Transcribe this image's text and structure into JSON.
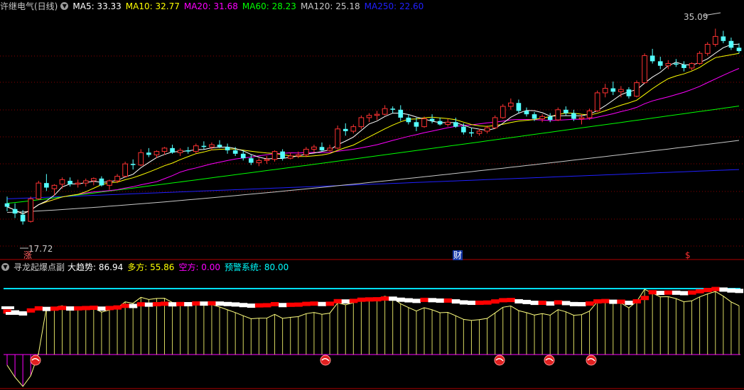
{
  "main_header": {
    "title": "许继电气(日线)",
    "indicators": [
      {
        "label": "MA5: 33.33",
        "color": "#ffffff"
      },
      {
        "label": "MA10: 32.77",
        "color": "#ffff00"
      },
      {
        "label": "MA20: 31.68",
        "color": "#ff00ff"
      },
      {
        "label": "MA60: 28.23",
        "color": "#00ff00"
      },
      {
        "label": "MA120: 25.18",
        "color": "#c8c8c8"
      },
      {
        "label": "MA250: 22.60",
        "color": "#2020ff"
      }
    ]
  },
  "sub_header": {
    "title": "寻龙起爆点副",
    "indicators": [
      {
        "label": "大趋势: 86.94",
        "color": "#ffffff"
      },
      {
        "label": "多方: 55.86",
        "color": "#ffff00"
      },
      {
        "label": "空方: 0.00",
        "color": "#ff00ff"
      },
      {
        "label": "预警系统: 80.00",
        "color": "#00ffff"
      }
    ]
  },
  "annotations": {
    "high_label": "35.09",
    "low_label": "17.72",
    "markers": [
      "涨",
      "财",
      "$"
    ]
  },
  "colors": {
    "up": "#ff3232",
    "down": "#54ffff",
    "grid": "#8b0000",
    "cyan_line": "#00e0ff",
    "osc_line": "#ffff80",
    "neg_bar": "#ff00ff",
    "band_up": "#ff0000",
    "band_down": "#ffffff"
  },
  "chart_data": {
    "type": "candlestick",
    "price_range": [
      15.5,
      36.5
    ],
    "high": 35.09,
    "low": 17.72,
    "moving_averages": {
      "MA5": 33.33,
      "MA10": 32.77,
      "MA20": 31.68,
      "MA60": 28.23,
      "MA120": 25.18,
      "MA250": 22.6
    },
    "oscillator": {
      "大趋势": 86.94,
      "多方": 55.86,
      "空方": 0.0,
      "预警系统": 80.0
    },
    "candles": [
      {
        "o": 19.6,
        "h": 20.2,
        "l": 18.9,
        "c": 19.3
      },
      {
        "o": 19.1,
        "h": 19.6,
        "l": 18.3,
        "c": 18.7
      },
      {
        "o": 18.6,
        "h": 19.0,
        "l": 17.72,
        "c": 18.0
      },
      {
        "o": 18.0,
        "h": 20.2,
        "l": 17.9,
        "c": 20.0
      },
      {
        "o": 20.0,
        "h": 21.6,
        "l": 19.9,
        "c": 21.4
      },
      {
        "o": 21.4,
        "h": 22.2,
        "l": 20.7,
        "c": 21.0
      },
      {
        "o": 20.9,
        "h": 21.3,
        "l": 20.3,
        "c": 21.2
      },
      {
        "o": 21.3,
        "h": 21.9,
        "l": 20.9,
        "c": 21.7
      },
      {
        "o": 21.6,
        "h": 21.9,
        "l": 21.1,
        "c": 21.3
      },
      {
        "o": 21.3,
        "h": 21.7,
        "l": 21.0,
        "c": 21.4
      },
      {
        "o": 21.4,
        "h": 21.8,
        "l": 21.1,
        "c": 21.6
      },
      {
        "o": 21.6,
        "h": 21.9,
        "l": 21.2,
        "c": 21.8
      },
      {
        "o": 21.8,
        "h": 22.0,
        "l": 21.1,
        "c": 21.2
      },
      {
        "o": 21.2,
        "h": 21.7,
        "l": 20.8,
        "c": 21.6
      },
      {
        "o": 21.6,
        "h": 22.2,
        "l": 21.4,
        "c": 22.0
      },
      {
        "o": 22.0,
        "h": 23.3,
        "l": 21.9,
        "c": 23.1
      },
      {
        "o": 23.1,
        "h": 23.5,
        "l": 22.6,
        "c": 23.0
      },
      {
        "o": 23.0,
        "h": 24.4,
        "l": 22.9,
        "c": 24.1
      },
      {
        "o": 24.1,
        "h": 24.5,
        "l": 23.7,
        "c": 23.9
      },
      {
        "o": 23.9,
        "h": 24.3,
        "l": 23.6,
        "c": 24.2
      },
      {
        "o": 24.2,
        "h": 24.6,
        "l": 23.9,
        "c": 24.5
      },
      {
        "o": 24.5,
        "h": 24.8,
        "l": 24.0,
        "c": 24.1
      },
      {
        "o": 24.1,
        "h": 24.5,
        "l": 23.8,
        "c": 24.3
      },
      {
        "o": 24.3,
        "h": 24.6,
        "l": 24.0,
        "c": 24.2
      },
      {
        "o": 24.2,
        "h": 24.9,
        "l": 24.0,
        "c": 24.7
      },
      {
        "o": 24.7,
        "h": 25.1,
        "l": 24.4,
        "c": 24.6
      },
      {
        "o": 24.6,
        "h": 25.0,
        "l": 24.3,
        "c": 24.8
      },
      {
        "o": 24.8,
        "h": 25.2,
        "l": 24.5,
        "c": 24.6
      },
      {
        "o": 24.6,
        "h": 24.9,
        "l": 24.0,
        "c": 24.3
      },
      {
        "o": 24.3,
        "h": 24.6,
        "l": 23.8,
        "c": 24.0
      },
      {
        "o": 24.0,
        "h": 24.3,
        "l": 23.4,
        "c": 23.6
      },
      {
        "o": 23.6,
        "h": 23.9,
        "l": 23.0,
        "c": 23.2
      },
      {
        "o": 23.2,
        "h": 23.6,
        "l": 22.9,
        "c": 23.4
      },
      {
        "o": 23.4,
        "h": 23.8,
        "l": 23.1,
        "c": 23.5
      },
      {
        "o": 23.5,
        "h": 24.3,
        "l": 23.3,
        "c": 24.2
      },
      {
        "o": 24.2,
        "h": 24.4,
        "l": 23.4,
        "c": 23.6
      },
      {
        "o": 23.6,
        "h": 24.1,
        "l": 23.5,
        "c": 23.8
      },
      {
        "o": 23.8,
        "h": 24.2,
        "l": 23.6,
        "c": 23.9
      },
      {
        "o": 23.9,
        "h": 24.6,
        "l": 23.7,
        "c": 24.4
      },
      {
        "o": 24.4,
        "h": 24.8,
        "l": 24.1,
        "c": 24.6
      },
      {
        "o": 24.6,
        "h": 25.0,
        "l": 24.2,
        "c": 24.3
      },
      {
        "o": 24.3,
        "h": 24.8,
        "l": 24.2,
        "c": 24.5
      },
      {
        "o": 24.5,
        "h": 26.5,
        "l": 24.4,
        "c": 26.2
      },
      {
        "o": 26.2,
        "h": 26.7,
        "l": 25.6,
        "c": 26.0
      },
      {
        "o": 26.0,
        "h": 26.6,
        "l": 25.8,
        "c": 26.4
      },
      {
        "o": 26.4,
        "h": 27.4,
        "l": 26.2,
        "c": 27.2
      },
      {
        "o": 27.2,
        "h": 27.6,
        "l": 26.8,
        "c": 27.4
      },
      {
        "o": 27.4,
        "h": 27.8,
        "l": 27.0,
        "c": 27.5
      },
      {
        "o": 27.5,
        "h": 28.3,
        "l": 27.4,
        "c": 28.0
      },
      {
        "o": 28.0,
        "h": 28.2,
        "l": 27.6,
        "c": 27.9
      },
      {
        "o": 27.9,
        "h": 28.3,
        "l": 26.9,
        "c": 27.2
      },
      {
        "o": 27.2,
        "h": 27.5,
        "l": 26.6,
        "c": 26.8
      },
      {
        "o": 26.8,
        "h": 27.2,
        "l": 26.0,
        "c": 26.4
      },
      {
        "o": 26.4,
        "h": 27.3,
        "l": 26.3,
        "c": 27.1
      },
      {
        "o": 27.1,
        "h": 27.5,
        "l": 26.7,
        "c": 26.9
      },
      {
        "o": 26.9,
        "h": 27.2,
        "l": 26.5,
        "c": 26.6
      },
      {
        "o": 26.6,
        "h": 27.1,
        "l": 26.4,
        "c": 26.8
      },
      {
        "o": 26.8,
        "h": 27.2,
        "l": 26.3,
        "c": 26.4
      },
      {
        "o": 26.4,
        "h": 26.7,
        "l": 25.7,
        "c": 25.9
      },
      {
        "o": 25.9,
        "h": 26.3,
        "l": 25.5,
        "c": 25.8
      },
      {
        "o": 25.8,
        "h": 26.2,
        "l": 25.6,
        "c": 26.0
      },
      {
        "o": 26.0,
        "h": 26.5,
        "l": 25.8,
        "c": 26.3
      },
      {
        "o": 26.3,
        "h": 27.4,
        "l": 26.2,
        "c": 27.2
      },
      {
        "o": 27.2,
        "h": 28.4,
        "l": 27.1,
        "c": 28.2
      },
      {
        "o": 28.2,
        "h": 28.9,
        "l": 27.9,
        "c": 28.5
      },
      {
        "o": 28.5,
        "h": 28.8,
        "l": 27.6,
        "c": 27.8
      },
      {
        "o": 27.8,
        "h": 28.1,
        "l": 27.3,
        "c": 27.5
      },
      {
        "o": 27.5,
        "h": 27.7,
        "l": 26.9,
        "c": 27.1
      },
      {
        "o": 27.1,
        "h": 27.5,
        "l": 26.8,
        "c": 27.3
      },
      {
        "o": 27.3,
        "h": 27.6,
        "l": 26.8,
        "c": 27.0
      },
      {
        "o": 27.0,
        "h": 28.1,
        "l": 26.9,
        "c": 27.9
      },
      {
        "o": 27.9,
        "h": 28.2,
        "l": 27.4,
        "c": 27.6
      },
      {
        "o": 27.6,
        "h": 27.9,
        "l": 26.9,
        "c": 27.1
      },
      {
        "o": 27.1,
        "h": 27.5,
        "l": 26.6,
        "c": 27.2
      },
      {
        "o": 27.2,
        "h": 28.0,
        "l": 27.0,
        "c": 27.8
      },
      {
        "o": 27.8,
        "h": 29.6,
        "l": 27.7,
        "c": 29.4
      },
      {
        "o": 29.4,
        "h": 30.2,
        "l": 29.0,
        "c": 29.8
      },
      {
        "o": 29.8,
        "h": 30.4,
        "l": 29.2,
        "c": 29.5
      },
      {
        "o": 29.5,
        "h": 30.0,
        "l": 29.0,
        "c": 29.7
      },
      {
        "o": 29.7,
        "h": 29.9,
        "l": 28.9,
        "c": 29.1
      },
      {
        "o": 29.1,
        "h": 30.5,
        "l": 29.0,
        "c": 30.3
      },
      {
        "o": 30.3,
        "h": 32.9,
        "l": 30.2,
        "c": 32.7
      },
      {
        "o": 32.7,
        "h": 33.3,
        "l": 32.0,
        "c": 32.2
      },
      {
        "o": 32.2,
        "h": 32.6,
        "l": 31.5,
        "c": 31.8
      },
      {
        "o": 31.8,
        "h": 32.3,
        "l": 31.5,
        "c": 32.0
      },
      {
        "o": 32.0,
        "h": 32.4,
        "l": 31.7,
        "c": 31.9
      },
      {
        "o": 31.9,
        "h": 32.2,
        "l": 31.3,
        "c": 31.6
      },
      {
        "o": 31.6,
        "h": 32.1,
        "l": 31.4,
        "c": 32.0
      },
      {
        "o": 32.0,
        "h": 33.1,
        "l": 31.9,
        "c": 32.9
      },
      {
        "o": 32.9,
        "h": 33.9,
        "l": 32.7,
        "c": 33.7
      },
      {
        "o": 33.7,
        "h": 35.09,
        "l": 33.5,
        "c": 34.4
      },
      {
        "o": 34.4,
        "h": 34.9,
        "l": 33.8,
        "c": 34.0
      },
      {
        "o": 34.0,
        "h": 34.3,
        "l": 33.2,
        "c": 33.4
      },
      {
        "o": 33.4,
        "h": 33.8,
        "l": 32.9,
        "c": 33.1
      }
    ]
  }
}
